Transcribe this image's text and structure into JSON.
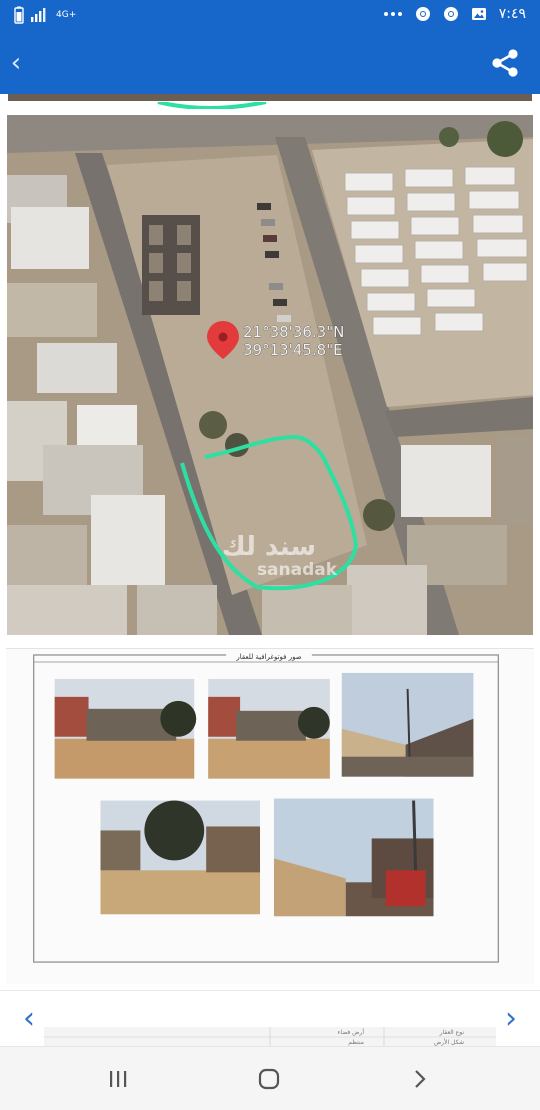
{
  "status_bar": {
    "network_label": "4G+",
    "time": "٧:٤٩",
    "icons": [
      "phone-signal-icon",
      "battery-icon",
      "gallery-icon",
      "chrome-icon",
      "chrome-icon",
      "more-dots-icon"
    ]
  },
  "app_bar": {
    "back_icon": "chevron-left-icon",
    "back_glyph": "‹",
    "share_icon": "share-icon"
  },
  "map": {
    "coord_line_1": "21°38'36.3\"N",
    "coord_line_2": "39°13'45.8\"E",
    "watermark_ar": "سند لك",
    "watermark_en": "sanadak",
    "boundary_color": "#2de0a2",
    "pin_color": "#e33b3b"
  },
  "photos_doc": {
    "title": "صور فوتوغرافية للعقار"
  },
  "next_doc_preview": {
    "cell_1": "نوع العقار",
    "cell_2": "أرض فضاء",
    "cell_3": "شكل الأرض",
    "cell_4": "منتظم"
  },
  "carousel": {
    "prev_glyph": "‹",
    "next_glyph": "›",
    "accent_color": "#2f74c9"
  },
  "bottom_nav": {
    "icons": [
      "recents-icon",
      "home-icon",
      "back-chevron-icon"
    ]
  }
}
